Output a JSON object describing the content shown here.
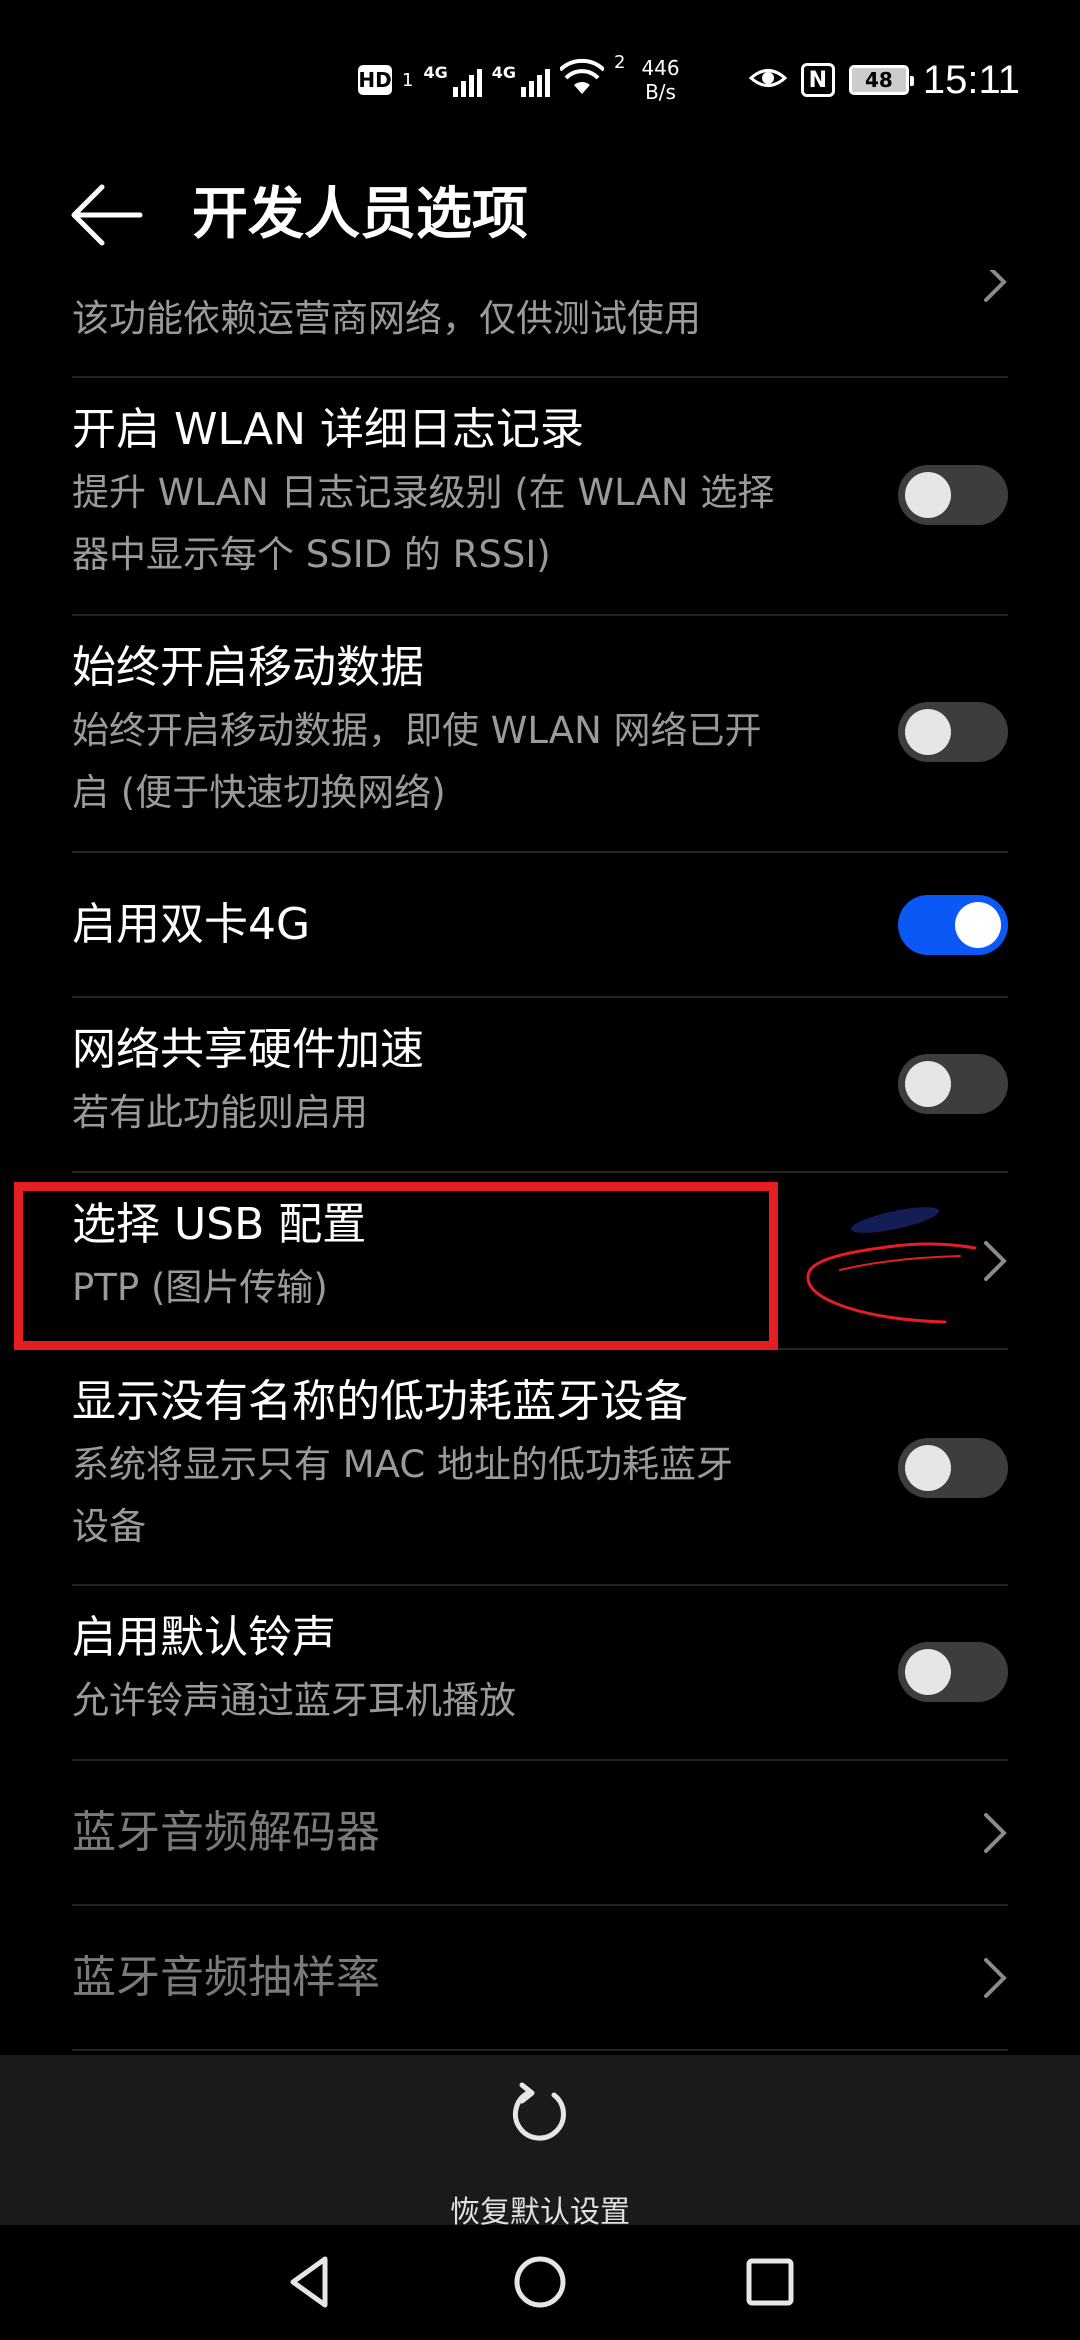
{
  "status_bar": {
    "hd_label": "HD",
    "sim1": "1",
    "net1": "4G",
    "net2": "4G",
    "wifi_sub": "2",
    "speed_value": "446",
    "speed_unit": "B/s",
    "nfc_label": "N",
    "battery_level": "48",
    "time": "15:11"
  },
  "header": {
    "back_icon": "back-arrow-icon",
    "title": "开发人员选项"
  },
  "settings": {
    "partial_item": {
      "summary": "该功能依赖运营商网络，仅供测试使用"
    },
    "wlan_verbose_logging": {
      "title": "开启 WLAN 详细日志记录",
      "summary_line1": "提升 WLAN 日志记录级别 (在 WLAN 选择",
      "summary_line2": "器中显示每个 SSID 的 RSSI)",
      "enabled": false
    },
    "mobile_data_always_on": {
      "title": "始终开启移动数据",
      "summary_line1": "始终开启移动数据，即使 WLAN 网络已开",
      "summary_line2": "启 (便于快速切换网络)",
      "enabled": false
    },
    "dual_4g": {
      "title": "启用双卡4G",
      "enabled": true
    },
    "tethering_hw_accel": {
      "title": "网络共享硬件加速",
      "summary": "若有此功能则启用",
      "enabled": false
    },
    "usb_config": {
      "title": "选择 USB 配置",
      "summary": "PTP (图片传输)"
    },
    "show_unnamed_ble": {
      "title": "显示没有名称的低功耗蓝牙设备",
      "summary_line1": "系统将显示只有 MAC 地址的低功耗蓝牙",
      "summary_line2": "设备",
      "enabled": false
    },
    "default_ringtone": {
      "title": "启用默认铃声",
      "summary": "允许铃声通过蓝牙耳机播放",
      "enabled": false
    },
    "bt_audio_codec": {
      "title": "蓝牙音频解码器"
    },
    "bt_audio_sample_rate": {
      "title": "蓝牙音频抽样率"
    }
  },
  "bottom_bar": {
    "reset_icon": "refresh-icon",
    "reset_label": "恢复默认设置"
  },
  "nav_bar": {
    "back": "nav-back-icon",
    "home": "nav-home-icon",
    "recents": "nav-recents-icon"
  },
  "colors": {
    "background": "#000000",
    "accent": "#0a59f7",
    "annotation_red": "#e41e23",
    "secondary_text": "#9a9a9a"
  }
}
